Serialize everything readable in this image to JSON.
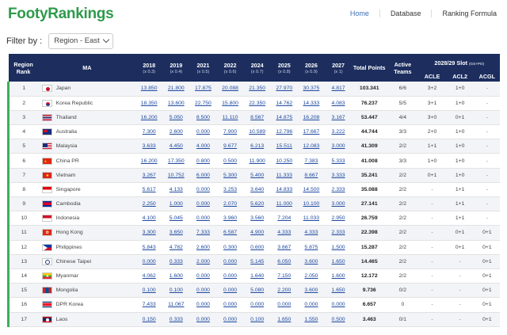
{
  "header": {
    "logo_part1": "Footy",
    "logo_part2": "Rankings",
    "nav": [
      {
        "label": "Home",
        "active": true
      },
      {
        "label": "Database",
        "active": false
      },
      {
        "label": "Ranking Formula",
        "active": false
      }
    ]
  },
  "filter": {
    "label": "Filter by :",
    "selected": "Region - East"
  },
  "table": {
    "headers": {
      "rank": "Region Rank",
      "ma": "MA",
      "years": [
        {
          "year": "2018",
          "mult": "(x 0.3)"
        },
        {
          "year": "2019",
          "mult": "(x 0.4)"
        },
        {
          "year": "2021",
          "mult": "(x 0.5)"
        },
        {
          "year": "2022",
          "mult": "(x 0.6)"
        },
        {
          "year": "2024",
          "mult": "(x 0.7)"
        },
        {
          "year": "2025",
          "mult": "(x 0.8)"
        },
        {
          "year": "2026",
          "mult": "(x 0.9)"
        },
        {
          "year": "2027",
          "mult": "(x 1)"
        }
      ],
      "total": "Total Points",
      "active": "Active Teams",
      "slot_title": "2028/29 Slot",
      "slot_note": "(GS+PO)",
      "slots": [
        "ACLE",
        "ACL2",
        "ACGL"
      ]
    },
    "rows": [
      {
        "rank": "1",
        "ma": "Japan",
        "flag": "jp",
        "v": [
          "13.850",
          "21.800",
          "17.875",
          "20.088",
          "21.350",
          "27.970",
          "30.375",
          "4.817"
        ],
        "total": "103.341",
        "active": "6/6",
        "acle": "3+2",
        "acl2": "1+0",
        "acgl": "-"
      },
      {
        "rank": "2",
        "ma": "Korea Republic",
        "flag": "kr",
        "v": [
          "18.350",
          "13.600",
          "22.750",
          "15.800",
          "22.350",
          "14.762",
          "14.333",
          "4.083"
        ],
        "total": "76.237",
        "active": "5/5",
        "acle": "3+1",
        "acl2": "1+0",
        "acgl": "-"
      },
      {
        "rank": "3",
        "ma": "Thailand",
        "flag": "th",
        "v": [
          "16.200",
          "5.050",
          "8.500",
          "11.110",
          "8.567",
          "14.875",
          "16.208",
          "3.167"
        ],
        "total": "53.447",
        "active": "4/4",
        "acle": "3+0",
        "acl2": "0+1",
        "acgl": "-"
      },
      {
        "rank": "4",
        "ma": "Australia",
        "flag": "au",
        "v": [
          "7.300",
          "2.600",
          "0.000",
          "7.900",
          "10.589",
          "12.796",
          "17.667",
          "3.222"
        ],
        "total": "44.744",
        "active": "3/3",
        "acle": "2+0",
        "acl2": "1+0",
        "acgl": "-"
      },
      {
        "rank": "5",
        "ma": "Malaysia",
        "flag": "my",
        "v": [
          "3.633",
          "4.450",
          "4.000",
          "9.677",
          "6.213",
          "15.511",
          "12.083",
          "3.000"
        ],
        "total": "41.309",
        "active": "2/2",
        "acle": "1+1",
        "acl2": "1+0",
        "acgl": "-"
      },
      {
        "rank": "6",
        "ma": "China PR",
        "flag": "cn",
        "v": [
          "16.200",
          "17.350",
          "0.800",
          "0.500",
          "11.900",
          "10.250",
          "7.383",
          "5.333"
        ],
        "total": "41.008",
        "active": "3/3",
        "acle": "1+0",
        "acl2": "1+0",
        "acgl": "-"
      },
      {
        "rank": "7",
        "ma": "Vietnam",
        "flag": "vn",
        "v": [
          "3.267",
          "10.752",
          "6.000",
          "5.300",
          "5.400",
          "11.333",
          "8.667",
          "3.333"
        ],
        "total": "35.241",
        "active": "2/2",
        "acle": "0+1",
        "acl2": "1+0",
        "acgl": "-"
      },
      {
        "rank": "8",
        "ma": "Singapore",
        "flag": "sg",
        "v": [
          "5.617",
          "4.133",
          "0.000",
          "3.253",
          "3.640",
          "14.833",
          "14.500",
          "2.333"
        ],
        "total": "35.088",
        "active": "2/2",
        "acle": "-",
        "acl2": "1+1",
        "acgl": "-"
      },
      {
        "rank": "9",
        "ma": "Cambodia",
        "flag": "kh",
        "v": [
          "2.250",
          "1.000",
          "0.000",
          "2.070",
          "5.620",
          "11.000",
          "10.100",
          "3.000"
        ],
        "total": "27.141",
        "active": "2/2",
        "acle": "-",
        "acl2": "1+1",
        "acgl": "-"
      },
      {
        "rank": "10",
        "ma": "Indonesia",
        "flag": "id",
        "v": [
          "4.100",
          "5.045",
          "0.000",
          "3.960",
          "3.560",
          "7.204",
          "11.033",
          "2.950"
        ],
        "total": "26.759",
        "active": "2/2",
        "acle": "-",
        "acl2": "1+1",
        "acgl": "-"
      },
      {
        "rank": "11",
        "ma": "Hong Kong",
        "flag": "hk",
        "v": [
          "3.300",
          "3.650",
          "7.333",
          "6.587",
          "4.900",
          "4.333",
          "4.333",
          "2.333"
        ],
        "total": "22.398",
        "active": "2/2",
        "acle": "-",
        "acl2": "0+1",
        "acgl": "0+1"
      },
      {
        "rank": "12",
        "ma": "Philippines",
        "flag": "ph",
        "v": [
          "5.843",
          "4.782",
          "2.600",
          "0.300",
          "0.600",
          "3.667",
          "5.875",
          "1.500"
        ],
        "total": "15.287",
        "active": "2/2",
        "acle": "-",
        "acl2": "0+1",
        "acgl": "0+1"
      },
      {
        "rank": "13",
        "ma": "Chinese Taipei",
        "flag": "tw",
        "v": [
          "0.000",
          "0.333",
          "2.000",
          "0.000",
          "5.145",
          "6.050",
          "3.600",
          "1.650"
        ],
        "total": "14.465",
        "active": "2/2",
        "acle": "-",
        "acl2": "-",
        "acgl": "0+1"
      },
      {
        "rank": "14",
        "ma": "Myanmar",
        "flag": "mm",
        "v": [
          "4.062",
          "1.600",
          "0.000",
          "0.000",
          "1.640",
          "7.150",
          "2.050",
          "1.600"
        ],
        "total": "12.172",
        "active": "2/2",
        "acle": "-",
        "acl2": "-",
        "acgl": "0+1"
      },
      {
        "rank": "15",
        "ma": "Mongolia",
        "flag": "mn",
        "v": [
          "0.100",
          "0.100",
          "0.000",
          "0.000",
          "5.080",
          "2.200",
          "3.600",
          "1.650"
        ],
        "total": "9.736",
        "active": "0/2",
        "acle": "-",
        "acl2": "-",
        "acgl": "0+1"
      },
      {
        "rank": "16",
        "ma": "DPR Korea",
        "flag": "kp",
        "v": [
          "7.433",
          "11.067",
          "0.000",
          "0.000",
          "0.000",
          "0.000",
          "0.000",
          "0.000"
        ],
        "total": "6.657",
        "active": "0",
        "acle": "-",
        "acl2": "-",
        "acgl": "0+1"
      },
      {
        "rank": "17",
        "ma": "Laos",
        "flag": "la",
        "v": [
          "0.150",
          "0.333",
          "0.000",
          "0.000",
          "0.100",
          "1.650",
          "1.550",
          "0.500"
        ],
        "total": "3.463",
        "active": "0/1",
        "acle": "-",
        "acl2": "-",
        "acgl": "0+1"
      }
    ]
  }
}
